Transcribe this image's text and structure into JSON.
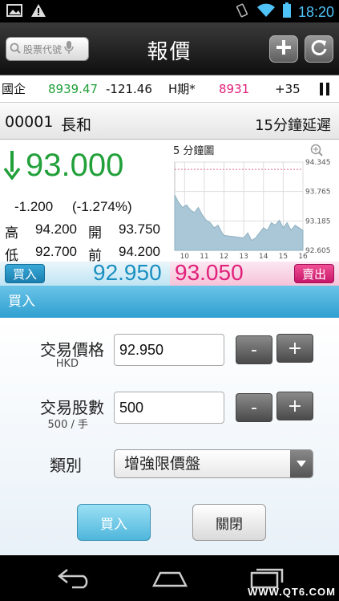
{
  "status_bar": {
    "time": "18:20",
    "icons": [
      "image-icon",
      "warning-icon",
      "vibrate-icon",
      "wifi-icon",
      "battery-icon"
    ]
  },
  "title_bar": {
    "search_placeholder": "股票代號",
    "title": "報價",
    "add_icon": "plus-icon",
    "refresh_icon": "refresh-icon"
  },
  "ticker": {
    "index_name": "國企",
    "index_value": "8939.47",
    "index_change": "-121.46",
    "futures_name": "H期*",
    "futures_value": "8931",
    "futures_change": "+35"
  },
  "stock": {
    "code": "00001",
    "name": "長和",
    "delay_note": "15分鐘延遲"
  },
  "quote": {
    "price": "93.000",
    "change": "-1.200",
    "change_pct": "(-1.274%)",
    "high_label": "高",
    "high": "94.200",
    "open_label": "開",
    "open": "93.750",
    "low_label": "低",
    "low": "92.700",
    "prev_label": "前",
    "prev": "94.200"
  },
  "chart_data": {
    "type": "line",
    "title": "5 分鐘圖",
    "x_ticks": [
      "10",
      "11",
      "12",
      "13",
      "14",
      "15",
      "16"
    ],
    "y_ticks": [
      "94.345",
      "93.765",
      "93.185",
      "92.605"
    ],
    "ylim": [
      92.605,
      94.345
    ],
    "xlim": [
      9.5,
      16
    ],
    "x": [
      9.5,
      9.7,
      9.9,
      10.1,
      10.3,
      10.5,
      10.7,
      10.9,
      11.1,
      11.3,
      11.5,
      11.7,
      11.9,
      12.0,
      13.0,
      13.2,
      13.4,
      13.6,
      13.8,
      14.0,
      14.2,
      14.4,
      14.6,
      14.8,
      15.0,
      15.2,
      15.4,
      15.6,
      15.8,
      16.0
    ],
    "values": [
      93.7,
      93.55,
      93.45,
      93.5,
      93.4,
      93.35,
      93.45,
      93.3,
      93.2,
      93.15,
      93.05,
      93.1,
      92.95,
      92.9,
      92.85,
      92.95,
      92.8,
      92.85,
      92.95,
      93.05,
      93.0,
      93.15,
      93.1,
      93.2,
      93.05,
      93.15,
      93.0,
      93.1,
      93.05,
      93.0
    ],
    "reference_line": 94.2,
    "zoom_icon": "zoom-icon"
  },
  "bid_ask": {
    "buy_label": "買入",
    "bid": "92.950",
    "ask": "93.050",
    "sell_label": "賣出"
  },
  "order_form": {
    "section_title": "買入",
    "price_label": "交易價格",
    "price_currency": "HKD",
    "price_value": "92.950",
    "qty_label": "交易股數",
    "qty_lot": "500 / 手",
    "qty_value": "500",
    "minus_label": "-",
    "plus_label": "+",
    "type_label": "類別",
    "type_value": "增強限價盤",
    "buy_button": "買入",
    "close_button": "關閉"
  },
  "nav": {
    "back_icon": "back-icon",
    "home_icon": "home-icon",
    "recents_icon": "recents-icon",
    "watermark": "WWW.QT6.COM"
  },
  "colors": {
    "up_green": "#22a03a",
    "bid_blue": "#1b8fc0",
    "ask_pink": "#e0207a",
    "chart_fill": "#a9c7d6"
  }
}
